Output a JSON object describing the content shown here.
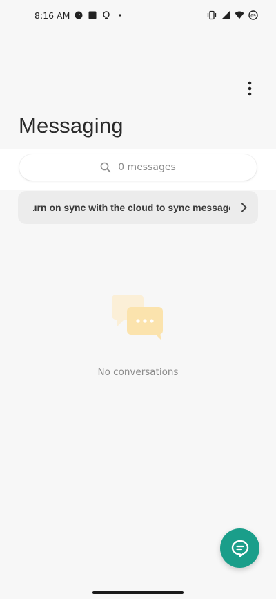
{
  "status_bar": {
    "time": "8:16 AM",
    "left_icons": [
      "google-pay-icon",
      "square-notification-icon",
      "lightbulb-icon",
      "dot-icon"
    ],
    "right_icons": [
      "vibrate-icon",
      "signal-icon",
      "wifi-icon",
      "battery-icon"
    ],
    "battery_level": "69"
  },
  "header": {
    "title": "Messaging",
    "menu_icon": "more-vert-icon"
  },
  "search": {
    "placeholder": "0 messages",
    "icon": "search-icon"
  },
  "sync_banner": {
    "text": "urn on sync with the cloud to sync messages",
    "icon": "chevron-right-icon"
  },
  "empty_state": {
    "icon": "chat-bubbles-icon",
    "text": "No conversations"
  },
  "fab": {
    "icon": "new-message-icon",
    "color": "#1a9e8a"
  }
}
